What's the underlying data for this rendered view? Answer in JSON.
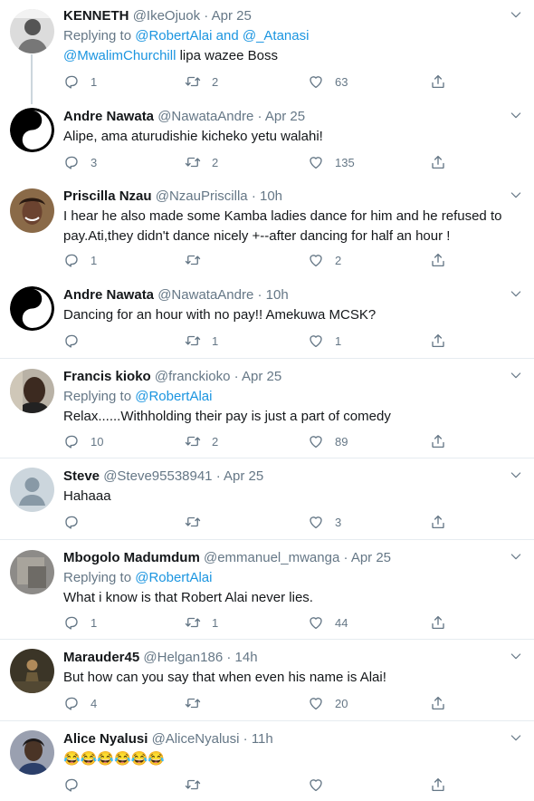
{
  "tweets": [
    {
      "name": "KENNETH",
      "handle": "@IkeOjuok",
      "sep": "·",
      "time": "Apr 25",
      "reply_prefix": "Replying to",
      "reply_to": "@RobertAlai and @_Atanasi",
      "text_mention": "@MwalimChurchill",
      "text": " lipa wazee Boss",
      "replies": "1",
      "retweets": "2",
      "likes": "63",
      "avatar": "person-bw-avatar"
    },
    {
      "name": "Andre Nawata",
      "handle": "@NawataAndre",
      "sep": "·",
      "time": "Apr 25",
      "text": "Alipe, ama aturudishie kicheko yetu walahi!",
      "replies": "3",
      "retweets": "2",
      "likes": "135",
      "avatar": "yin-yang-avatar"
    },
    {
      "name": "Priscilla Nzau",
      "handle": "@NzauPriscilla",
      "sep": "·",
      "time": "10h",
      "text_line1": "I hear he also made some Kamba ladies dance for him and he refused to",
      "text_line2": "pay.Ati,they didn't dance nicely +--after dancing for half an hour !",
      "replies": "1",
      "retweets": "",
      "likes": "2",
      "avatar": "woman-avatar"
    },
    {
      "name": "Andre Nawata",
      "handle": "@NawataAndre",
      "sep": "·",
      "time": "10h",
      "text": "Dancing for an hour with no pay!! Amekuwa MCSK?",
      "replies": "",
      "retweets": "1",
      "likes": "1",
      "avatar": "yin-yang-avatar"
    },
    {
      "name": "Francis kioko",
      "handle": "@franckioko",
      "sep": "·",
      "time": "Apr 25",
      "reply_prefix": "Replying to",
      "reply_to": "@RobertAlai",
      "text": "Relax......Withholding their pay is just a part of comedy",
      "replies": "10",
      "retweets": "2",
      "likes": "89",
      "avatar": "man-selfie-avatar"
    },
    {
      "name": "Steve",
      "handle": "@Steve95538941",
      "sep": "·",
      "time": "Apr 25",
      "text": "Hahaaa",
      "replies": "",
      "retweets": "",
      "likes": "3",
      "avatar": "default-avatar"
    },
    {
      "name": "Mbogolo Madumdum",
      "handle": "@emmanuel_mwanga",
      "sep": "·",
      "time": "Apr 25",
      "reply_prefix": "Replying to",
      "reply_to": "@RobertAlai",
      "text": "What i know is that Robert Alai never lies.",
      "replies": "1",
      "retweets": "1",
      "likes": "44",
      "avatar": "blurry-avatar"
    },
    {
      "name": "Marauder45",
      "handle": "@Helgan186",
      "sep": "·",
      "time": "14h",
      "text": "But how can you say that when even his name is Alai!",
      "replies": "4",
      "retweets": "",
      "likes": "20",
      "avatar": "figure-avatar"
    },
    {
      "name": "Alice Nyalusi",
      "handle": "@AliceNyalusi",
      "sep": "·",
      "time": "11h",
      "text": "😂😂😂😂😂😂",
      "replies": "",
      "retweets": "",
      "likes": "",
      "avatar": "woman-portrait-avatar"
    }
  ],
  "colors": {
    "link": "#1b95e0",
    "muted": "#657786",
    "divider": "#e6ecf0"
  },
  "icons": [
    "chevron-down-icon",
    "reply-icon",
    "retweet-icon",
    "like-icon",
    "share-icon"
  ]
}
